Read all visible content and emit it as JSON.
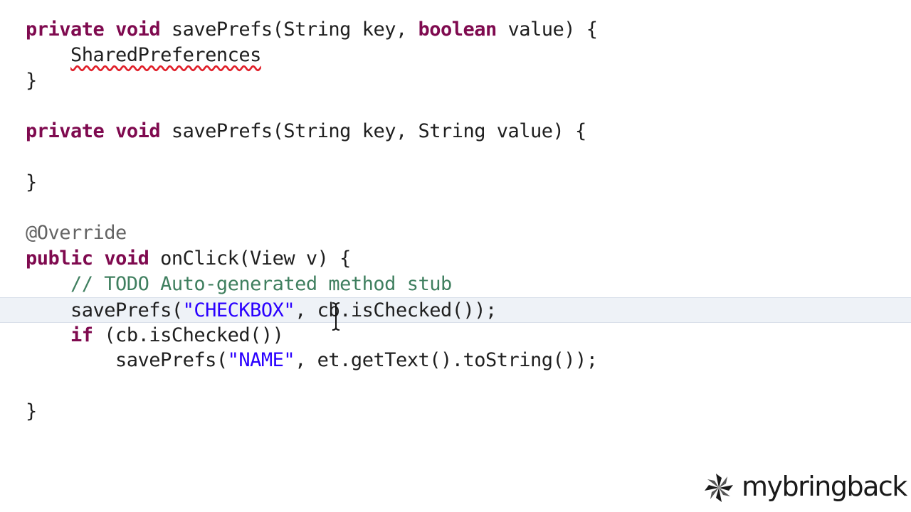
{
  "editor": {
    "lines": [
      {
        "tokens": [
          {
            "t": "private",
            "k": "kw"
          },
          {
            "t": " "
          },
          {
            "t": "void",
            "k": "kw"
          },
          {
            "t": " savePrefs(String key, "
          },
          {
            "t": "boolean",
            "k": "kw"
          },
          {
            "t": " value) {"
          }
        ]
      },
      {
        "tokens": [
          {
            "t": "    "
          },
          {
            "t": "SharedPreferences",
            "k": "err"
          }
        ]
      },
      {
        "tokens": [
          {
            "t": "}"
          }
        ]
      },
      {
        "tokens": []
      },
      {
        "tokens": [
          {
            "t": "private",
            "k": "kw"
          },
          {
            "t": " "
          },
          {
            "t": "void",
            "k": "kw"
          },
          {
            "t": " savePrefs(String key, String value) {"
          }
        ]
      },
      {
        "tokens": []
      },
      {
        "tokens": [
          {
            "t": "}"
          }
        ]
      },
      {
        "tokens": []
      },
      {
        "tokens": [
          {
            "t": "@Override",
            "k": "an"
          }
        ]
      },
      {
        "tokens": [
          {
            "t": "public",
            "k": "kw"
          },
          {
            "t": " "
          },
          {
            "t": "void",
            "k": "kw"
          },
          {
            "t": " onClick(View v) {"
          }
        ]
      },
      {
        "tokens": [
          {
            "t": "    "
          },
          {
            "t": "// TODO Auto-generated method stub",
            "k": "cm"
          }
        ]
      },
      {
        "tokens": [
          {
            "t": "    savePrefs("
          },
          {
            "t": "\"CHECKBOX\"",
            "k": "str"
          },
          {
            "t": ", cb.isChecked());"
          }
        ],
        "current": true
      },
      {
        "tokens": [
          {
            "t": "    "
          },
          {
            "t": "if",
            "k": "kw"
          },
          {
            "t": " (cb.isChecked())"
          }
        ]
      },
      {
        "tokens": [
          {
            "t": "        savePrefs("
          },
          {
            "t": "\"NAME\"",
            "k": "str"
          },
          {
            "t": ", et.getText().toString());"
          }
        ]
      },
      {
        "tokens": []
      },
      {
        "tokens": [
          {
            "t": "}"
          }
        ]
      }
    ]
  },
  "colors": {
    "keyword": "#7f0a4f",
    "comment": "#3f7f5f",
    "string": "#2a00ff",
    "annotation": "#646464",
    "error_underline": "#e0202a",
    "current_line": "#eef2f7"
  },
  "icons": {
    "cursor": "text-cursor-icon",
    "logo": "pinwheel-logo-icon"
  },
  "logo": {
    "text": "mybringback"
  }
}
